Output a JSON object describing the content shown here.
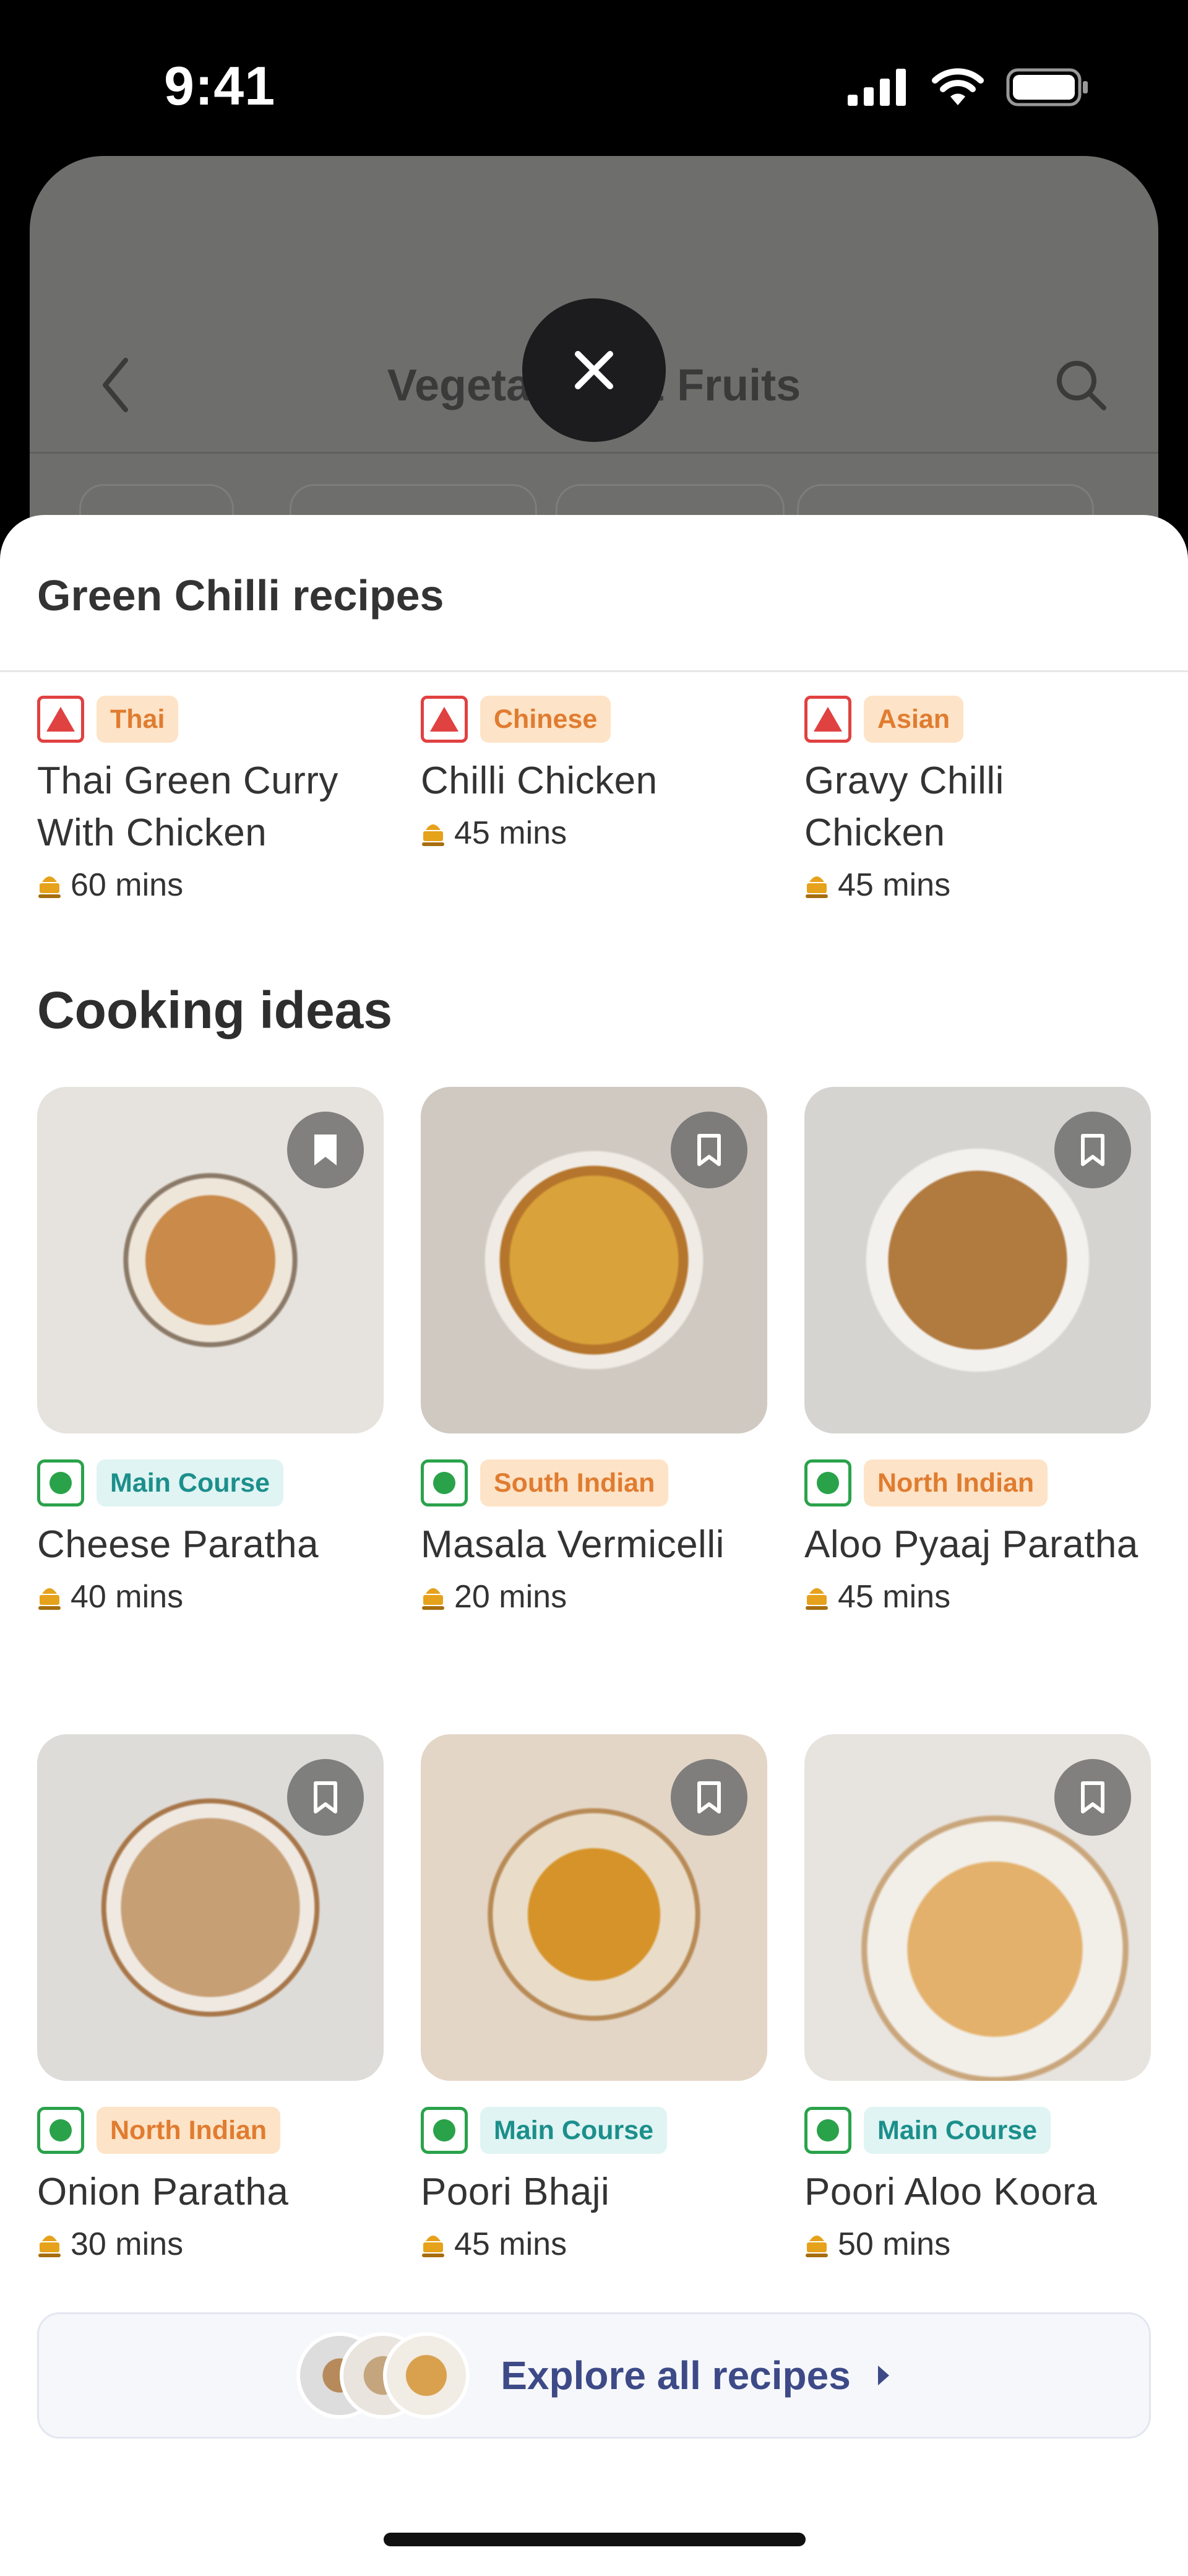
{
  "status_bar": {
    "time": "9:41"
  },
  "background_screen": {
    "title": "Vegetables & Fruits"
  },
  "sheet": {
    "title": "Green Chilli recipes",
    "green_chilli_recipes": [
      {
        "cuisine": "Thai",
        "name": "Thai Green Curry With Chicken",
        "time": "60 mins",
        "diet": "non-veg"
      },
      {
        "cuisine": "Chinese",
        "name": "Chilli Chicken",
        "time": "45 mins",
        "diet": "non-veg"
      },
      {
        "cuisine": "Asian",
        "name": "Gravy Chilli Chicken",
        "time": "45 mins",
        "diet": "non-veg"
      }
    ],
    "cooking_ideas_title": "Cooking ideas",
    "cooking_ideas": [
      {
        "tag": "Main Course",
        "tag_color": "teal",
        "name": "Cheese Paratha",
        "time": "40 mins",
        "diet": "veg",
        "bookmark": "filled"
      },
      {
        "tag": "South Indian",
        "tag_color": "orange",
        "name": "Masala Vermicelli",
        "time": "20 mins",
        "diet": "veg",
        "bookmark": "outline"
      },
      {
        "tag": "North Indian",
        "tag_color": "orange",
        "name": "Aloo Pyaaj Paratha",
        "time": "45 mins",
        "diet": "veg",
        "bookmark": "outline"
      },
      {
        "tag": "North Indian",
        "tag_color": "orange",
        "name": "Onion Paratha",
        "time": "30 mins",
        "diet": "veg",
        "bookmark": "outline"
      },
      {
        "tag": "Main Course",
        "tag_color": "teal",
        "name": "Poori Bhaji",
        "time": "45 mins",
        "diet": "veg",
        "bookmark": "outline"
      },
      {
        "tag": "Main Course",
        "tag_color": "teal",
        "name": "Poori Aloo Koora",
        "time": "50 mins",
        "diet": "veg",
        "bookmark": "outline"
      }
    ],
    "explore_label": "Explore all recipes"
  },
  "colors": {
    "non_veg": "#e04141",
    "veg": "#2aa24a",
    "tag_orange_bg": "#fde3c7",
    "tag_orange_text": "#e07c30",
    "tag_teal_bg": "#dff4f3",
    "tag_teal_text": "#1c8f8b",
    "explore_text": "#3d4a87"
  }
}
